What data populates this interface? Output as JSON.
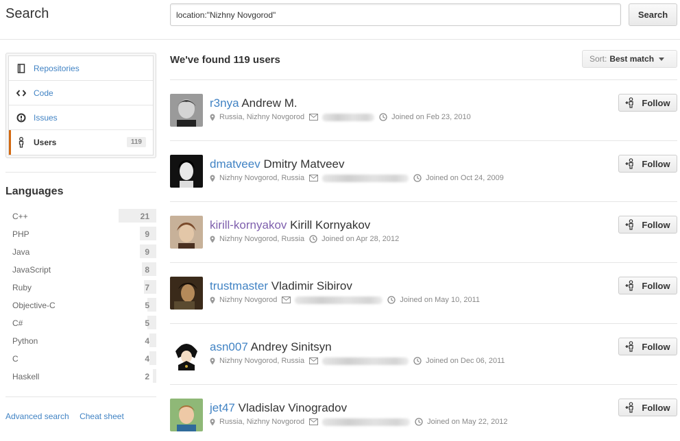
{
  "header": {
    "title": "Search",
    "query": "location:\"Nizhny Novgorod\"",
    "search_button": "Search"
  },
  "sidebar": {
    "filters": [
      {
        "label": "Repositories",
        "icon": "repo-icon"
      },
      {
        "label": "Code",
        "icon": "code-icon"
      },
      {
        "label": "Issues",
        "icon": "issue-icon"
      },
      {
        "label": "Users",
        "icon": "person-icon",
        "count": "119",
        "selected": true
      }
    ],
    "languages_title": "Languages",
    "languages": [
      {
        "name": "C++",
        "count": "21"
      },
      {
        "name": "PHP",
        "count": "9"
      },
      {
        "name": "Java",
        "count": "9"
      },
      {
        "name": "JavaScript",
        "count": "8"
      },
      {
        "name": "Ruby",
        "count": "7"
      },
      {
        "name": "Objective-C",
        "count": "5"
      },
      {
        "name": "C#",
        "count": "5"
      },
      {
        "name": "Python",
        "count": "4"
      },
      {
        "name": "C",
        "count": "4"
      },
      {
        "name": "Haskell",
        "count": "2"
      }
    ],
    "links": {
      "advanced": "Advanced search",
      "cheat": "Cheat sheet"
    }
  },
  "results": {
    "count_text": "We've found 119 users",
    "sort_label": "Sort:",
    "sort_value": "Best match",
    "follow_label": "Follow",
    "users": [
      {
        "login": "r3nya",
        "name": "Andrew M.",
        "location": "Russia, Nizhny Novgorod",
        "joined": "Joined on Feb 23, 2010",
        "has_email": true
      },
      {
        "login": "dmatveev",
        "name": "Dmitry Matveev",
        "location": "Nizhny Novgorod, Russia",
        "joined": "Joined on Oct 24, 2009",
        "has_email": true
      },
      {
        "login": "kirill-kornyakov",
        "name": "Kirill Kornyakov",
        "location": "Nizhny Novgorod, Russia",
        "joined": "Joined on Apr 28, 2012",
        "has_email": false
      },
      {
        "login": "trustmaster",
        "name": "Vladimir Sibirov",
        "location": "Nizhny Novgorod",
        "joined": "Joined on May 10, 2011",
        "has_email": true
      },
      {
        "login": "asn007",
        "name": "Andrey Sinitsyn",
        "location": "Nizhny Novgorod, Russia",
        "joined": "Joined on Dec 06, 2011",
        "has_email": true
      },
      {
        "login": "jet47",
        "name": "Vladislav Vinogradov",
        "location": "Russia, Nizhny Novgorod",
        "joined": "Joined on May 22, 2012",
        "has_email": true
      }
    ]
  },
  "colors": {
    "link": "#4183c4",
    "visited": "#7e5fad",
    "accent": "#d26911"
  }
}
